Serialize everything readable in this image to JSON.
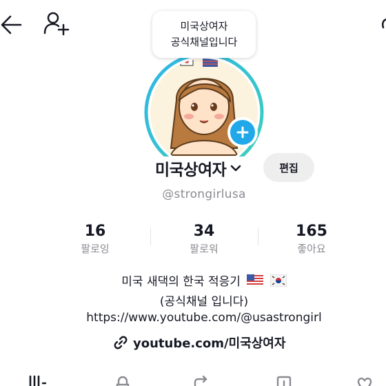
{
  "header": {
    "back_icon": "arrow-left-icon",
    "add_friend_icon": "add-user-icon"
  },
  "note": {
    "line1": "미국상여자",
    "line2": "공식채널입니다"
  },
  "profile": {
    "display_name": "미국상여자",
    "edit_label": "편집",
    "username": "@strongirlusa",
    "ring_color": "#35c1c9",
    "accent_color": "#20a8e8"
  },
  "stats": [
    {
      "value": "16",
      "label": "팔로잉"
    },
    {
      "value": "34",
      "label": "팔로워"
    },
    {
      "value": "165",
      "label": "좋아요"
    }
  ],
  "bio": {
    "line1": "미국 새댁의 한국 적응기",
    "line2": "(공식채널 입니다)",
    "line3": "https://www.youtube.com/@usastrongirl"
  },
  "link": {
    "text": "youtube.com/미국상여자",
    "icon": "link-icon"
  },
  "tabs": [
    "grid-icon",
    "lock-icon",
    "repost-icon",
    "saved-icon",
    "heart-icon"
  ]
}
